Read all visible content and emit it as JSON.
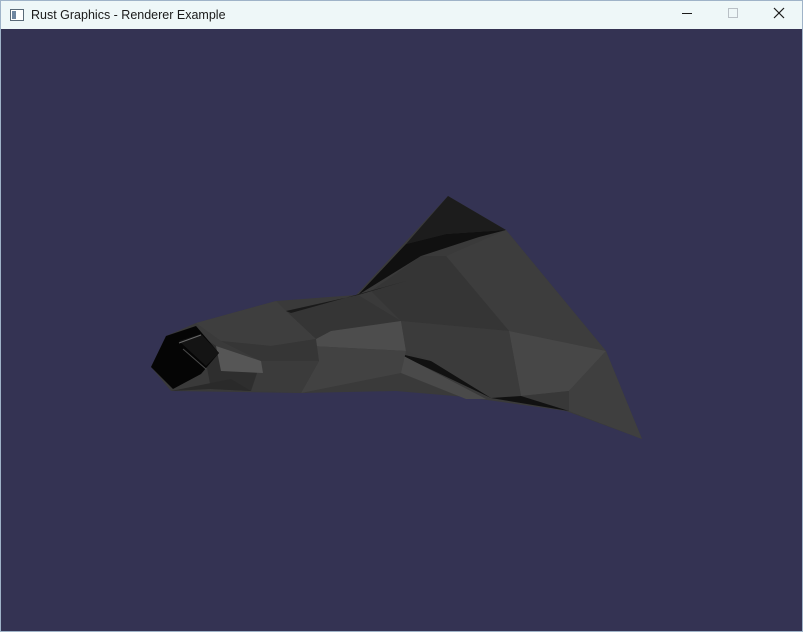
{
  "window": {
    "title": "Rust Graphics - Renderer Example"
  },
  "icons": {
    "app": "app-window-icon",
    "minimize": "minimize-icon",
    "maximize": "maximize-icon",
    "close": "close-icon"
  },
  "colors": {
    "titlebar_bg": "#eef7f8",
    "viewport_bg": "#343353",
    "model_base": "#3a3a3a"
  }
}
